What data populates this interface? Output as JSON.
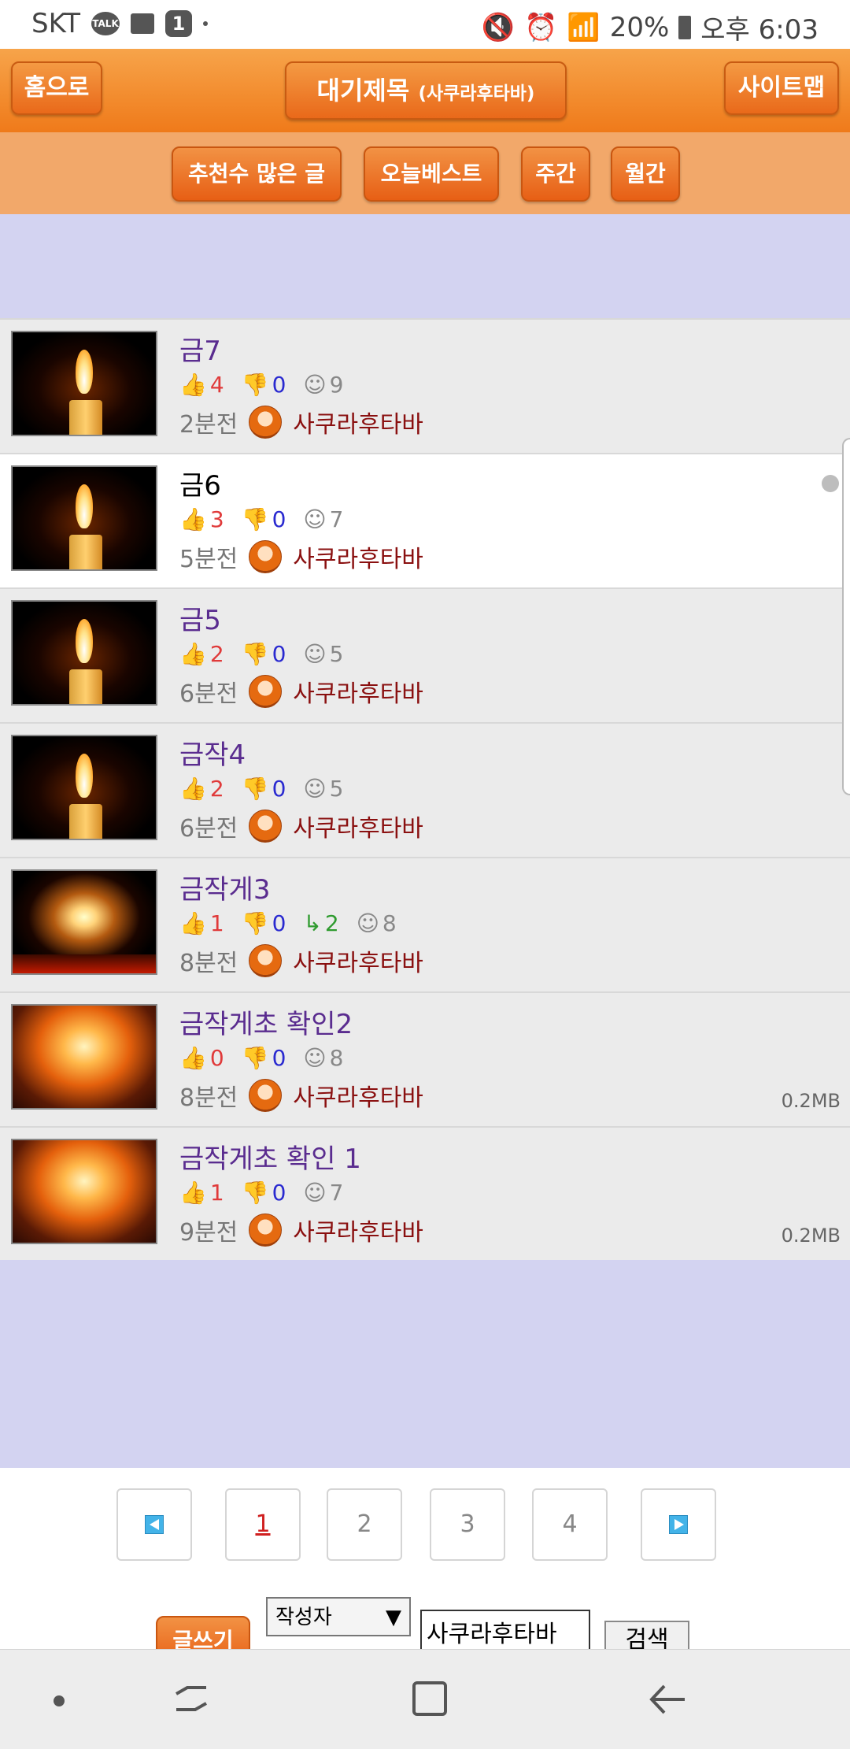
{
  "status": {
    "carrier": "SKT",
    "talk_badge": "TALK",
    "notif_count": "1",
    "battery": "20%",
    "time": "오후 6:03"
  },
  "header": {
    "home": "홈으로",
    "title": "대기제목",
    "title_sub": "(사쿠라후타바)",
    "sitemap": "사이트맵"
  },
  "subnav": [
    "추천수 많은 글",
    "오늘베스트",
    "주간",
    "월간"
  ],
  "posts": [
    {
      "title": "금7",
      "up": "4",
      "down": "0",
      "views": "9",
      "time": "2분전",
      "author": "사쿠라후타바",
      "thumb": "candle"
    },
    {
      "title": "금6",
      "up": "3",
      "down": "0",
      "views": "7",
      "time": "5분전",
      "author": "사쿠라후타바",
      "thumb": "candle"
    },
    {
      "title": "금5",
      "up": "2",
      "down": "0",
      "views": "5",
      "time": "6분전",
      "author": "사쿠라후타바",
      "thumb": "candle"
    },
    {
      "title": "금작4",
      "up": "2",
      "down": "0",
      "views": "5",
      "time": "6분전",
      "author": "사쿠라후타바",
      "thumb": "candle"
    },
    {
      "title": "금작게3",
      "up": "1",
      "down": "0",
      "replies": "2",
      "views": "8",
      "time": "8분전",
      "author": "사쿠라후타바",
      "thumb": "blurflame"
    },
    {
      "title": "금작게초 확인2",
      "up": "0",
      "down": "0",
      "views": "8",
      "time": "8분전",
      "author": "사쿠라후타바",
      "size": "0.2MB",
      "thumb": "fire"
    },
    {
      "title": "금작게초 확인 1",
      "up": "1",
      "down": "0",
      "views": "7",
      "time": "9분전",
      "author": "사쿠라후타바",
      "size": "0.2MB",
      "thumb": "fire"
    }
  ],
  "pagination": {
    "pages": [
      "1",
      "2",
      "3",
      "4"
    ],
    "current": "1"
  },
  "search": {
    "write": "글쓰기",
    "field_option": "작성자",
    "caret": "▼",
    "query": "사쿠라후타바",
    "button": "검색"
  }
}
